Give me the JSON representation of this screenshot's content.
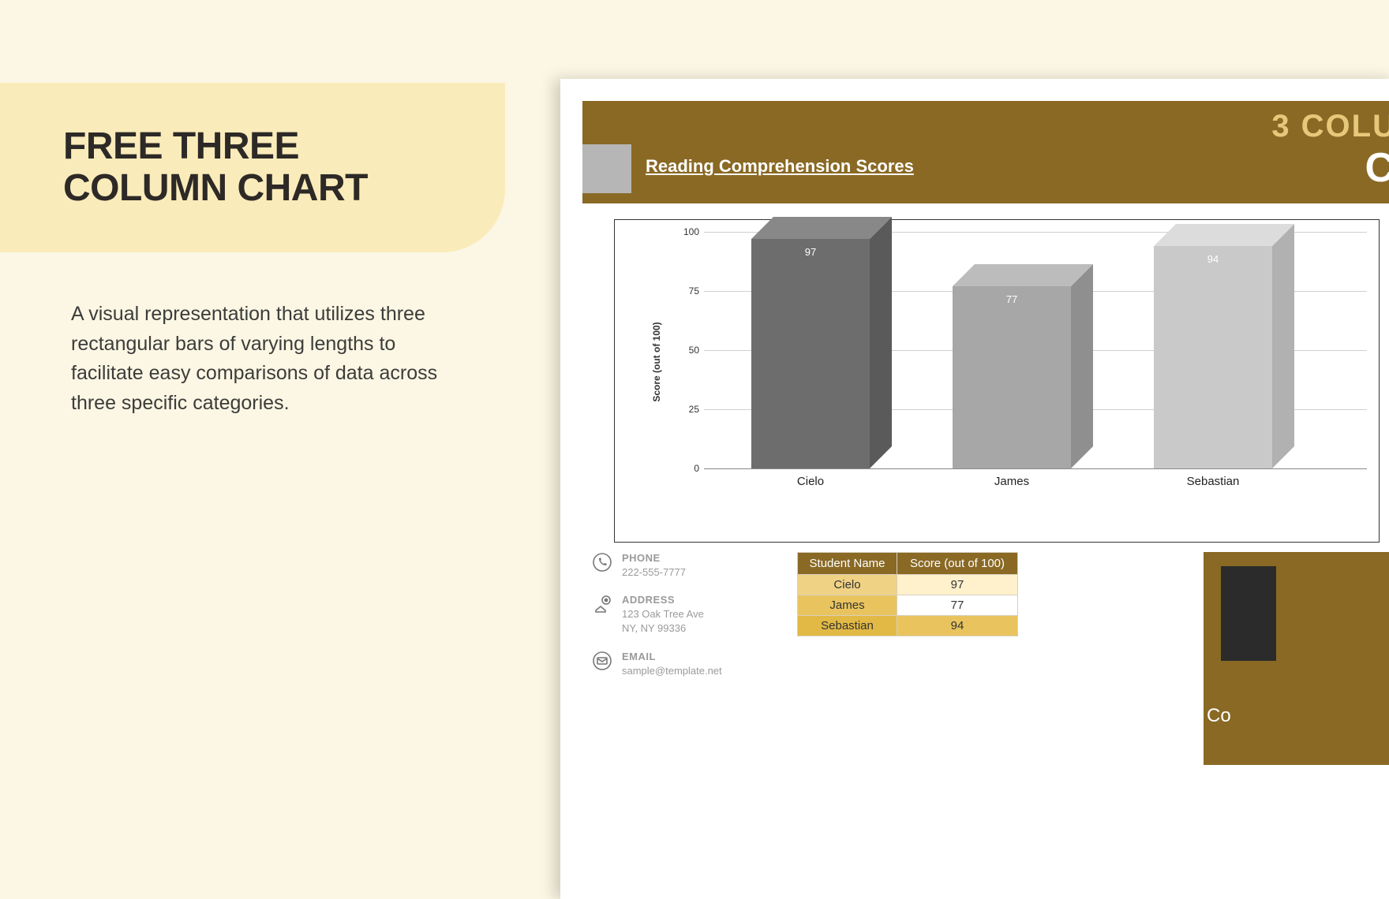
{
  "left_panel": {
    "title_line1": "FREE THREE",
    "title_line2": "COLUMN CHART",
    "description": "A visual representation that utilizes three rectangular bars of varying lengths to facilitate easy comparisons of data across three specific categories."
  },
  "document": {
    "header": {
      "subtitle": "Reading Comprehension Scores",
      "big_line1": "3 COLU",
      "big_line2": "C"
    },
    "contact": {
      "phone_label": "PHONE",
      "phone_value": "222-555-7777",
      "address_label": "ADDRESS",
      "address_line1": "123 Oak Tree Ave",
      "address_line2": "NY, NY 99336",
      "email_label": "EMAIL",
      "email_value": "sample@template.net"
    },
    "table": {
      "col1": "Student Name",
      "col2": "Score (out of 100)",
      "rows": [
        {
          "name": "Cielo",
          "score": "97"
        },
        {
          "name": "James",
          "score": "77"
        },
        {
          "name": "Sebastian",
          "score": "94"
        }
      ]
    },
    "side_caption": "Co"
  },
  "chart_data": {
    "type": "bar",
    "title": "Reading Comprehension Scores",
    "xlabel": "",
    "ylabel": "Score (out of 100)",
    "ylim": [
      0,
      100
    ],
    "yticks": [
      0,
      25,
      50,
      75,
      100
    ],
    "categories": [
      "Cielo",
      "James",
      "Sebastian"
    ],
    "values": [
      97,
      77,
      94
    ],
    "bar_colors_front": [
      "#6d6d6d",
      "#a7a7a7",
      "#c9c9c9"
    ],
    "bar_colors_side": [
      "#5a5a5a",
      "#8f8f8f",
      "#b1b1b1"
    ],
    "bar_colors_top": [
      "#888888",
      "#bcbcbc",
      "#dcdcdc"
    ]
  }
}
